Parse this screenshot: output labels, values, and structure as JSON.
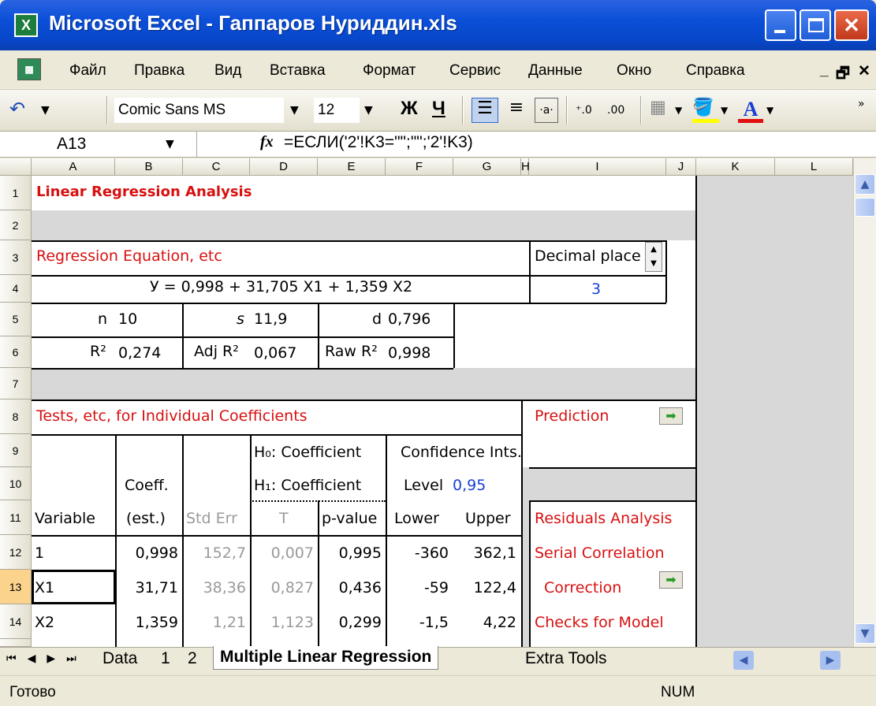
{
  "window": {
    "title": "Microsoft Excel - Гаппаров Нуриддин.xls",
    "app_icon": "excel-icon"
  },
  "menu": [
    "Файл",
    "Правка",
    "Вид",
    "Вставка",
    "Формат",
    "Сервис",
    "Данные",
    "Окно",
    "Справка"
  ],
  "toolbar": {
    "font": "Comic Sans MS",
    "size": "12",
    "bold": "Ж",
    "underline": "Ч"
  },
  "formula_bar": {
    "name_box": "A13",
    "fx": "fx",
    "formula": "=ЕСЛИ('2'!K3=\"\";\"\";'2'!K3)"
  },
  "columns": [
    "A",
    "B",
    "C",
    "D",
    "E",
    "F",
    "G",
    "H",
    "I",
    "J",
    "K",
    "L"
  ],
  "rows": [
    "1",
    "2",
    "3",
    "4",
    "5",
    "6",
    "7",
    "8",
    "9",
    "10",
    "11",
    "12",
    "13",
    "14"
  ],
  "cells": {
    "title": "Linear Regression Analysis",
    "reg_eq_label": "Regression Equation, etc",
    "equation": "У = 0,998 + 31,705 X1 + 1,359 X2",
    "decimal_label": "Decimal place",
    "decimal_value": "3",
    "n_label": "n",
    "n_val": "10",
    "s_label": "s",
    "s_val": "11,9",
    "d_label": "d",
    "d_val": "0,796",
    "r2_label": "R²",
    "r2_val": "0,274",
    "adj_label": "Adj R²",
    "adj_val": "0,067",
    "raw_label": "Raw R²",
    "raw_val": "0,998",
    "tests_label": "Tests, etc, for Individual Coefficients",
    "prediction": "Prediction",
    "h0": "H₀: Coefficient",
    "conf": "Confidence Ints.",
    "h1": "H₁: Coefficient",
    "level_label": "Level",
    "level_val": "0,95",
    "coeff_head": "Coeff.",
    "hdr": [
      "Variable",
      "(est.)",
      "Std Err",
      "T",
      "p-value",
      "Lower",
      "Upper"
    ],
    "residuals": "Residuals Analysis",
    "serial": "Serial Correlation",
    "correction": "Correction",
    "checks": "Checks for Model"
  },
  "table": [
    [
      "1",
      "0,998",
      "152,7",
      "0,007",
      "0,995",
      "-360",
      "362,1"
    ],
    [
      "X1",
      "31,71",
      "38,36",
      "0,827",
      "0,436",
      "-59",
      "122,4"
    ],
    [
      "X2",
      "1,359",
      "1,21",
      "1,123",
      "0,299",
      "-1,5",
      "4,22"
    ]
  ],
  "tabs": [
    "Data",
    "1",
    "2",
    "Multiple Linear Regression",
    "Extra Tools"
  ],
  "status": {
    "left": "Готово",
    "num": "NUM"
  }
}
